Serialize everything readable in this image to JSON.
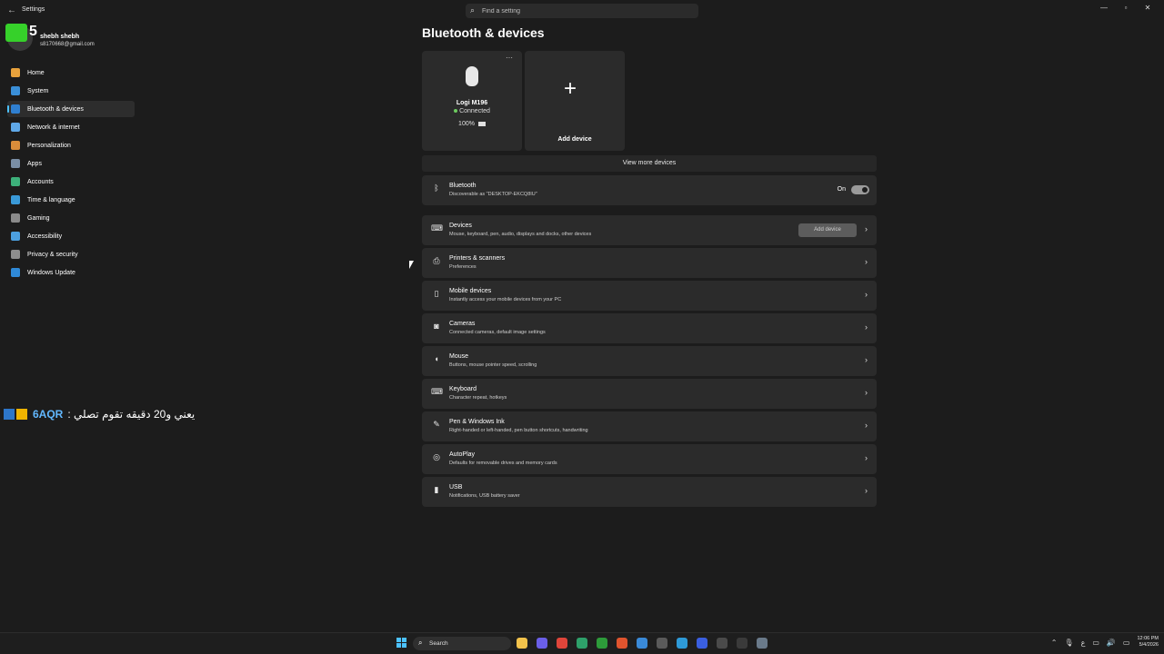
{
  "window": {
    "title": "Settings",
    "back_glyph": "←",
    "controls": [
      "—",
      "▫",
      "✕"
    ]
  },
  "search": {
    "placeholder": "Find a setting"
  },
  "overlay": {
    "number": "5",
    "badge_color": "#36d12a"
  },
  "profile": {
    "name": "shebh shebh",
    "email": "s8170668@gmail.com"
  },
  "nav": {
    "items": [
      {
        "label": "Home",
        "icon": "home-icon",
        "color": "#e8a23c"
      },
      {
        "label": "System",
        "icon": "system-icon",
        "color": "#3a8fd8"
      },
      {
        "label": "Bluetooth & devices",
        "icon": "bluetooth-icon",
        "color": "#2f7fd0",
        "selected": true
      },
      {
        "label": "Network & internet",
        "icon": "network-icon",
        "color": "#5fa8e8"
      },
      {
        "label": "Personalization",
        "icon": "brush-icon",
        "color": "#d98c3a"
      },
      {
        "label": "Apps",
        "icon": "apps-icon",
        "color": "#7a8fa6"
      },
      {
        "label": "Accounts",
        "icon": "accounts-icon",
        "color": "#3db07a"
      },
      {
        "label": "Time & language",
        "icon": "globe-icon",
        "color": "#3a9ad8"
      },
      {
        "label": "Gaming",
        "icon": "gaming-icon",
        "color": "#8a8a8a"
      },
      {
        "label": "Accessibility",
        "icon": "accessibility-icon",
        "color": "#4ca0e0"
      },
      {
        "label": "Privacy & security",
        "icon": "shield-icon",
        "color": "#8d8d8d"
      },
      {
        "label": "Windows Update",
        "icon": "update-icon",
        "color": "#2f8ad8"
      }
    ]
  },
  "stream_overlay": {
    "code": "6AQR",
    "message": "يعني و20 دقيقه تقوم تصلي :"
  },
  "main": {
    "title": "Bluetooth & devices",
    "device_card": {
      "more_glyph": "···",
      "name": "Logi M196",
      "status": "Connected",
      "battery": "100%"
    },
    "add_card": {
      "plus_glyph": "+",
      "label": "Add device"
    },
    "view_more": "View more devices",
    "bluetooth": {
      "title": "Bluetooth",
      "subtitle": "Discoverable as \"DESKTOP-EKCQ8IU\"",
      "state_label": "On",
      "icon_glyph": "ᛒ",
      "enabled": true
    },
    "rows": [
      {
        "title": "Devices",
        "subtitle": "Mouse, keyboard, pen, audio, displays and docks, other devices",
        "icon": "devices-icon",
        "glyph": "⌨",
        "button": "Add device"
      },
      {
        "title": "Printers & scanners",
        "subtitle": "Preferences",
        "icon": "printer-icon",
        "glyph": "⎙"
      },
      {
        "title": "Mobile devices",
        "subtitle": "Instantly access your mobile devices from your PC",
        "icon": "phone-icon",
        "glyph": "▯"
      },
      {
        "title": "Cameras",
        "subtitle": "Connected cameras, default image settings",
        "icon": "camera-icon",
        "glyph": "◙"
      },
      {
        "title": "Mouse",
        "subtitle": "Buttons, mouse pointer speed, scrolling",
        "icon": "mouse-icon",
        "glyph": "◖"
      },
      {
        "title": "Keyboard",
        "subtitle": "Character repeat, hotkeys",
        "icon": "keyboard-icon",
        "glyph": "⌨"
      },
      {
        "title": "Pen & Windows Ink",
        "subtitle": "Right-handed or left-handed, pen button shortcuts, handwriting",
        "icon": "pen-icon",
        "glyph": "✎"
      },
      {
        "title": "AutoPlay",
        "subtitle": "Defaults for removable drives and memory cards",
        "icon": "autoplay-icon",
        "glyph": "◎"
      },
      {
        "title": "USB",
        "subtitle": "Notifications, USB battery saver",
        "icon": "usb-icon",
        "glyph": "▮"
      }
    ],
    "chevron_glyph": "›"
  },
  "taskbar": {
    "search_label": "Search",
    "search_glyph": "⌕",
    "apps": [
      {
        "name": "file-explorer-icon",
        "color": "#f2c24b"
      },
      {
        "name": "discord-icon",
        "color": "#6a5fe8"
      },
      {
        "name": "chrome-icon",
        "color": "#e0453a"
      },
      {
        "name": "spreadsheet-app-icon",
        "color": "#2ea06a"
      },
      {
        "name": "xbox-icon",
        "color": "#2d9b3a"
      },
      {
        "name": "brave-icon",
        "color": "#e0542e"
      },
      {
        "name": "vpn-icon",
        "color": "#3a8ad8"
      },
      {
        "name": "store-icon",
        "color": "#5a5a5a"
      },
      {
        "name": "edge-icon",
        "color": "#2e9ad8"
      },
      {
        "name": "blue-app-icon",
        "color": "#3a5fe0"
      },
      {
        "name": "terminal-icon",
        "color": "#4a4a4a"
      },
      {
        "name": "cmd-icon",
        "color": "#3a3a3a"
      },
      {
        "name": "settings-app-icon",
        "color": "#6a7a8a"
      }
    ],
    "tray": {
      "chevron": "⌃",
      "mic": "🎙",
      "lang": "ع",
      "net": "▭",
      "vol": "🔊",
      "batt": "▭"
    },
    "time": "12:06 PM",
    "date": "5/4/2026"
  }
}
